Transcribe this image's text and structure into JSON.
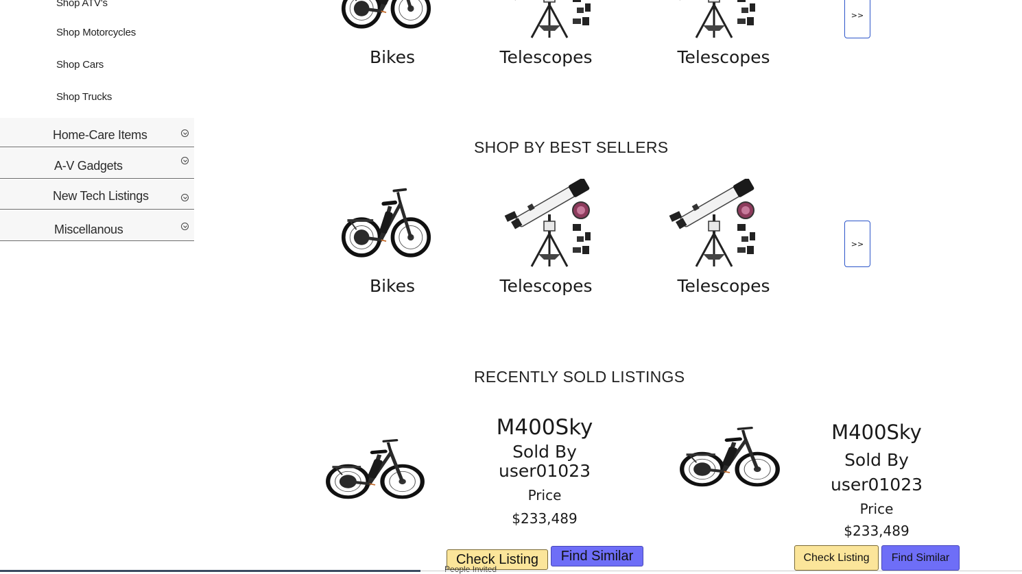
{
  "sidebar": {
    "sub_links": [
      "Shop ATV's",
      "Shop Motorcycles",
      "Shop Cars",
      "Shop Trucks"
    ],
    "categories": [
      "Home-Care Items",
      "A-V Gadgets",
      "New Tech Listings",
      "Miscellanous"
    ]
  },
  "top_row": {
    "items": [
      {
        "label": "Bikes",
        "icon": "ebike-icon"
      },
      {
        "label": "Telescopes",
        "icon": "telescope-icon"
      },
      {
        "label": "Telescopes",
        "icon": "telescope-icon"
      }
    ],
    "next_label": ">>"
  },
  "best_sellers": {
    "heading": "SHOP BY BEST SELLERS",
    "items": [
      {
        "label": "Bikes",
        "icon": "ebike-icon"
      },
      {
        "label": "Telescopes",
        "icon": "telescope-icon"
      },
      {
        "label": "Telescopes",
        "icon": "telescope-icon"
      }
    ],
    "next_label": ">>"
  },
  "recently_sold": {
    "heading": "RECENTLY SOLD LISTINGS",
    "listings": [
      {
        "name": "M400Sky",
        "sold_by": "Sold By",
        "seller": "user01023",
        "price_label": "Price",
        "price": "$233,489",
        "check_label": "Check Listing",
        "similar_label": "Find Similar"
      },
      {
        "name": "M400Sky",
        "sold_by": "Sold By",
        "seller": "user01023",
        "price_label": "Price",
        "price": "$233,489",
        "check_label": "Check Listing",
        "similar_label": "Find Similar"
      }
    ]
  },
  "footer_peek": "People Invited",
  "colors": {
    "check_button": "#fbe59a",
    "similar_button": "#6e6ef7",
    "next_button_border": "#2a54c9",
    "sidebar_bg": "#f7f7f7"
  }
}
